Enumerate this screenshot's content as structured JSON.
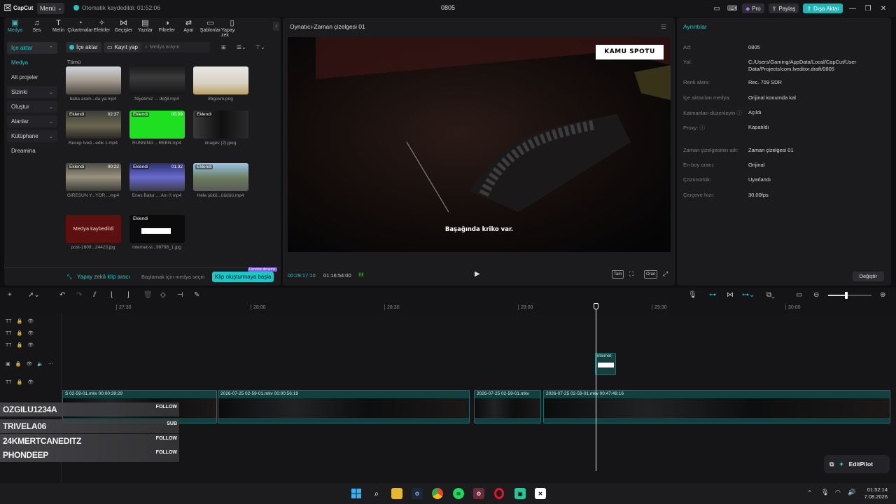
{
  "titlebar": {
    "app_name": "CapCut",
    "menu_label": "Menü",
    "autosave_text": "Otomatik kaydedildi: 01:52:06",
    "project_title": "0805",
    "pro_label": "Pro",
    "share_label": "Paylaş",
    "export_label": "Dışa Aktar"
  },
  "tools": [
    {
      "label": "Medya",
      "icon": "media-icon",
      "active": true
    },
    {
      "label": "Ses",
      "icon": "audio-icon"
    },
    {
      "label": "Metin",
      "icon": "text-icon"
    },
    {
      "label": "Çıkartmalar",
      "icon": "sticker-icon"
    },
    {
      "label": "Efektler",
      "icon": "effects-icon"
    },
    {
      "label": "Geçişler",
      "icon": "transitions-icon"
    },
    {
      "label": "Yazılar",
      "icon": "captions-icon"
    },
    {
      "label": "Filtreler",
      "icon": "filters-icon"
    },
    {
      "label": "Ayar",
      "icon": "adjust-icon"
    },
    {
      "label": "Şablonlar",
      "icon": "templates-icon"
    },
    {
      "label": "Yapay zek",
      "icon": "ai-icon"
    }
  ],
  "nav": {
    "items": [
      {
        "label": "İçe aktar",
        "style": "head"
      },
      {
        "label": "Medya",
        "style": "sel"
      },
      {
        "label": "Alt projeler",
        "style": "plain"
      },
      {
        "label": "Sizinki",
        "style": "chev"
      },
      {
        "label": "Oluştur",
        "style": "chev"
      },
      {
        "label": "Alanlar",
        "style": "chev"
      },
      {
        "label": "Kütüphane",
        "style": "chev"
      },
      {
        "label": "Dreamina",
        "style": "plain"
      }
    ]
  },
  "media": {
    "import_label": "İçe aktar",
    "record_label": "Kayıt yap",
    "search_placeholder": "Medya arayın",
    "all_label": "Tümü",
    "items": [
      {
        "name": "baba aram...da ya.mp4",
        "badge": "",
        "duration": ""
      },
      {
        "name": "Niyetimiz ... değil.mp4",
        "badge": "",
        "duration": ""
      },
      {
        "name": "8bgoxm.png",
        "badge": "",
        "duration": ""
      },
      {
        "name": "Recep İved...edik 1.mp4",
        "badge": "Eklendi",
        "duration": "02:37"
      },
      {
        "name": "RUNNING ...REEN.mp4",
        "badge": "Eklendi",
        "duration": "00:09"
      },
      {
        "name": "images (2).jpeg",
        "badge": "Eklendi",
        "duration": ""
      },
      {
        "name": "GİRESUN Y...YOR....mp4",
        "badge": "Eklendi",
        "duration": "00:22"
      },
      {
        "name": "Enes Batur ... Anı !!.mp4",
        "badge": "Eklendi",
        "duration": "01:32"
      },
      {
        "name": "Hele şükü...üüüüü.mp4",
        "badge": "Eklendi",
        "duration": ""
      },
      {
        "name": "post-1609...24423.jpg",
        "badge": "",
        "duration": "",
        "missing": "Medya kaybedildi"
      },
      {
        "name": "internet-si...99798_1.jpg",
        "badge": "Eklendi",
        "duration": ""
      }
    ],
    "ai_tool_label": "Yapay zekâ klip aracı",
    "ai_hint": "Başlamak için medya seçin",
    "start_button": "Klip oluşturmaya başla",
    "free_tag": "Ücretsiz deneme"
  },
  "player": {
    "title": "Oynatıcı-Zaman çizelgesi 01",
    "overlay_box": "KAMU SPOTU",
    "subtitle": "Başağında kriko var.",
    "current_time": "00:29:17:10",
    "total_time": "01:16:54:00",
    "full_label": "Tam",
    "ratio_label": "Oran"
  },
  "details": {
    "title": "Ayrıntılar",
    "rows": [
      {
        "k": "Ad:",
        "v": "0805"
      },
      {
        "k": "Yol:",
        "v": "C:/Users/Gaming/AppData/Local/CapCut/User Data/Projects/com.lveditor.draft/0805"
      },
      {
        "k": "Renk alanı:",
        "v": "Rec. 709 SDR"
      },
      {
        "k": "İçe aktarılan medya:",
        "v": "Orijinal konumda kal"
      },
      {
        "k": "Katmanları düzenleyin ⓘ",
        "v": "Açıldı"
      },
      {
        "k": "Proxy: ⓘ",
        "v": "Kapatıldı"
      },
      {
        "k": "Zaman çizelgesinin adı:",
        "v": "Zaman çizelgesi 01"
      },
      {
        "k": "En boy oranı:",
        "v": "Orijinal"
      },
      {
        "k": "Çözünürlük:",
        "v": "Uyarlandı"
      },
      {
        "k": "Çerçeve hızı:",
        "v": "30.00fps"
      }
    ],
    "change_button": "Değiştir"
  },
  "timeline": {
    "ruler_labels": [
      "27:30",
      "28:00",
      "28:30",
      "29:00",
      "29:30",
      "30:00"
    ],
    "sticker_clip_label": "internet-",
    "video_clips": [
      {
        "label": "S 02-59-01.mkv  00:00:39:29"
      },
      {
        "label": "2026-07-25 02-59-01.mkv  00:00:56:19"
      },
      {
        "label": "2026-07-25 02-59-01.mkv"
      },
      {
        "label": "2026-07-25 02-59-01.mkv  00:47:48:16"
      }
    ]
  },
  "overlay_users": [
    {
      "name": "OZGILU1234A",
      "tag": "FOLLOW"
    },
    {
      "name": "TRIVELA06",
      "tag": "SUB"
    },
    {
      "name": "24KMERTCANEDITZ",
      "tag": "FOLLOW"
    },
    {
      "name": "PHONDEEP",
      "tag": "FOLLOW"
    }
  ],
  "editpilot_label": "EditPilot",
  "taskbar": {
    "time": "01:52:14",
    "date": "7.08.2026"
  },
  "colors": {
    "accent": "#22c5c5",
    "panel": "#1b1b1e",
    "background": "#0e0e10"
  }
}
